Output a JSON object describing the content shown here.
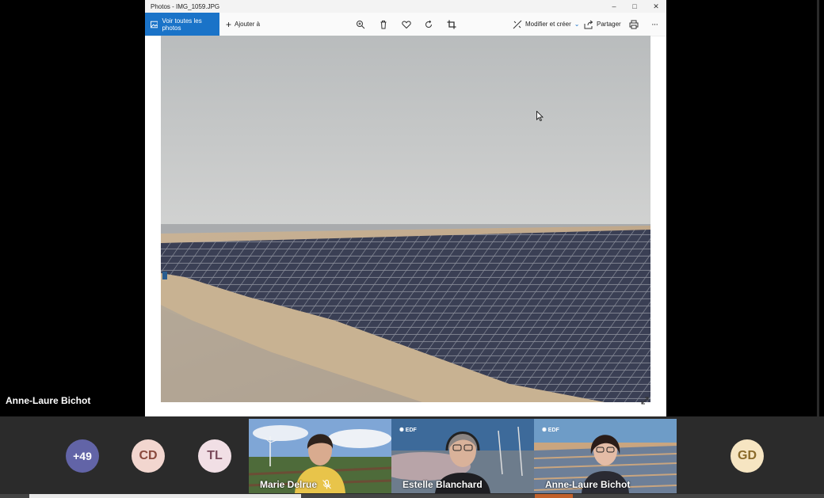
{
  "photos_window": {
    "title": "Photos - IMG_1059.JPG",
    "toolbar": {
      "see_all_label": "Voir toutes les photos",
      "add_to_label": "Ajouter à",
      "edit_create_label": "Modifier et créer",
      "share_label": "Partager"
    }
  },
  "presenter": {
    "name": "Anne-Laure Bichot"
  },
  "participants": {
    "overflow_count": "+49",
    "avatars": [
      {
        "initials": "CD",
        "color": "#f2d6cf"
      },
      {
        "initials": "TL",
        "color": "#f1dfe5"
      },
      {
        "initials": "GD",
        "color": "#f6e5c2"
      }
    ],
    "video_tiles": [
      {
        "name": "Marie Delrue",
        "muted": true
      },
      {
        "name": "Estelle Blanchard",
        "muted": false
      },
      {
        "name": "Anne-Laure Bichot",
        "muted": false
      }
    ]
  },
  "colors": {
    "accent": "#1a73c8",
    "overflow_avatar": "#6264a7"
  }
}
